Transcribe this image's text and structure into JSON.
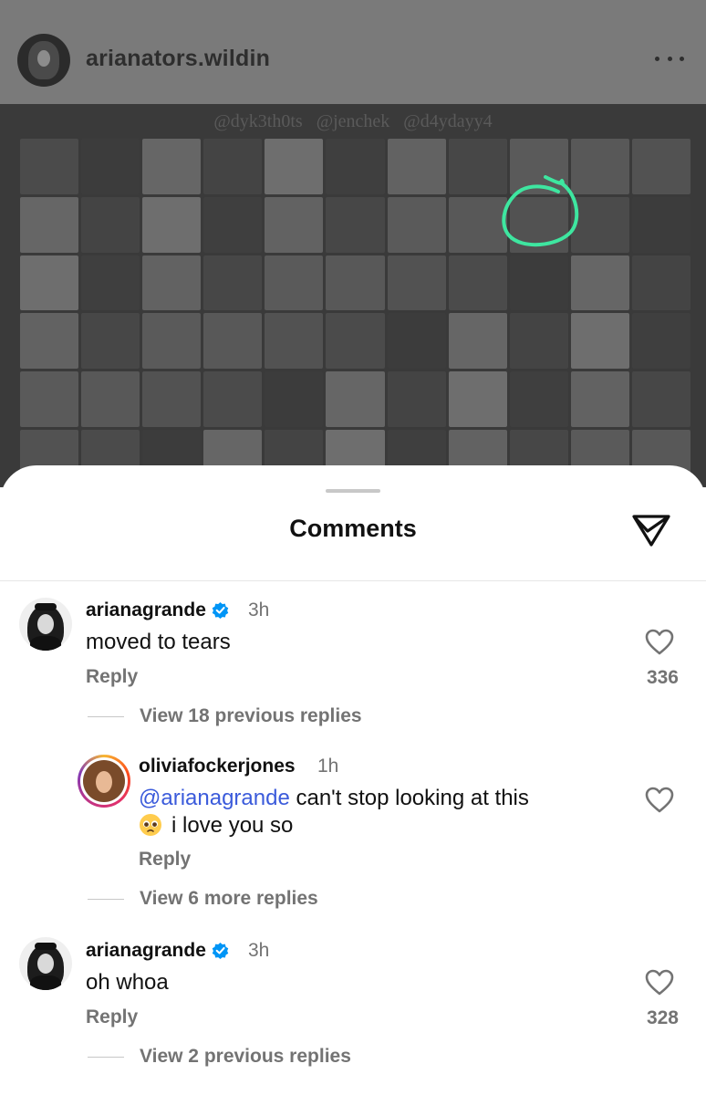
{
  "post": {
    "username": "arianators.wildin",
    "watermark": "@dyk3th0ts @jenchek @d4ydayy4"
  },
  "comments_sheet": {
    "title": "Comments"
  },
  "comments": [
    {
      "username": "arianagrande",
      "verified": true,
      "time": "3h",
      "text": "moved to tears",
      "reply_label": "Reply",
      "likes": "336",
      "view_replies": "View 18 previous replies"
    },
    {
      "username": "oliviafockerjones",
      "verified": false,
      "time": "1h",
      "mention": "@arianagrande",
      "text_line1": "can't stop looking at this",
      "text_line2": "i love you so",
      "emoji": "pleading-face-emoji",
      "reply_label": "Reply",
      "view_replies": "View 6 more replies"
    },
    {
      "username": "arianagrande",
      "verified": true,
      "time": "3h",
      "text": "oh whoa",
      "reply_label": "Reply",
      "likes": "328",
      "view_replies": "View 2 previous replies"
    }
  ],
  "colors": {
    "dim_overlay": "#7a7a7a",
    "verified_blue": "#0095f6",
    "mention_blue": "#3b5bdb",
    "highlight_green": "#3ee6a0",
    "secondary_text": "#737373"
  },
  "icons": [
    "more-icon",
    "share-icon",
    "verified-badge-icon",
    "heart-icon"
  ]
}
